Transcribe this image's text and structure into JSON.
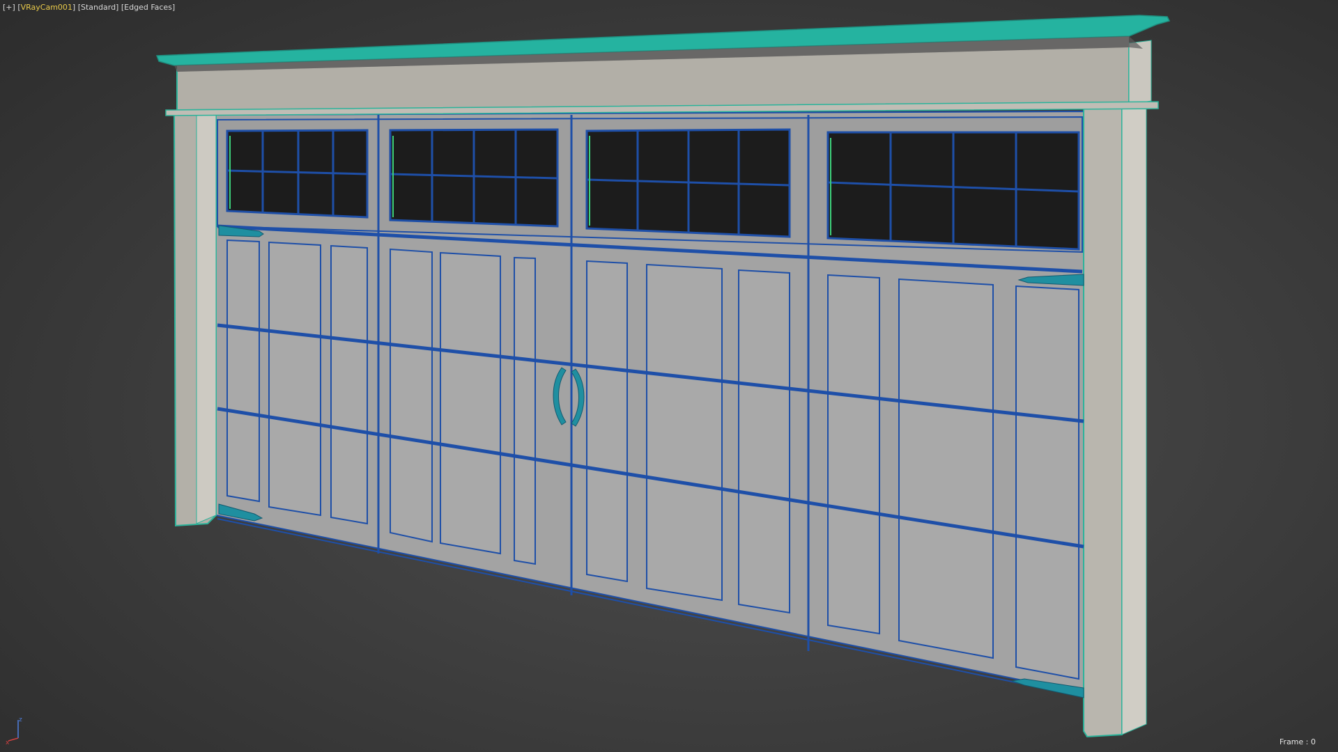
{
  "viewport": {
    "menu_plus": "[+]",
    "camera_bracket_open": "[",
    "camera_name": "VRayCam001",
    "camera_bracket_close": "]",
    "shading_standard": "[Standard]",
    "shading_edged": "[Edged Faces]"
  },
  "status": {
    "frame_label": "Frame : 0"
  },
  "gizmo": {
    "axis_z": "z",
    "axis_x": "x"
  },
  "scene": {
    "object": "garage door with trim",
    "panel_sections": 4,
    "window_rows": 2,
    "window_columns_per_section": 4,
    "colors": {
      "background": "#3c3c3c",
      "door_face": "#a7a7a7",
      "trim_face": "#b9b6ae",
      "edge_wire": "#1e4fa8",
      "selection_wire": "#2ab39a",
      "window_glass": "#1a1a1a"
    }
  }
}
